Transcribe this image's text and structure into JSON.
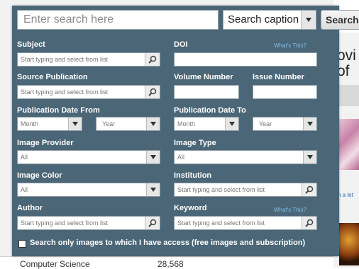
{
  "search": {
    "placeholder": "Enter search here",
    "scope": "Search caption",
    "button": "Search"
  },
  "fields": {
    "subject": {
      "label": "Subject",
      "placeholder": "Start typing and select from list"
    },
    "doi": {
      "label": "DOI",
      "help": "What's This?"
    },
    "source_publication": {
      "label": "Source Publication",
      "placeholder": "Start typing and select from list"
    },
    "volume_number": {
      "label": "Volume Number"
    },
    "issue_number": {
      "label": "Issue Number"
    },
    "pub_date_from": {
      "label": "Publication Date From",
      "month": "Month",
      "year": "Year"
    },
    "pub_date_to": {
      "label": "Publication Date To",
      "month": "Month",
      "year": "Year"
    },
    "image_provider": {
      "label": "Image Provider",
      "value": "All"
    },
    "image_type": {
      "label": "Image Type",
      "value": "All"
    },
    "image_color": {
      "label": "Image Color",
      "value": "All"
    },
    "institution": {
      "label": "Institution",
      "placeholder": "Start typing and select from list"
    },
    "author": {
      "label": "Author",
      "placeholder": "Start typing and select from list"
    },
    "keyword": {
      "label": "Keyword",
      "help": "What's This?",
      "placeholder": "Start typing and select from list"
    }
  },
  "access_checkbox": {
    "label": "Search only images to which I have access (free images and subscription)",
    "checked": false
  },
  "background": {
    "heading": "ovi\nof",
    "link": "n a let",
    "list_name": "Computer Science",
    "list_count": "28,568"
  }
}
